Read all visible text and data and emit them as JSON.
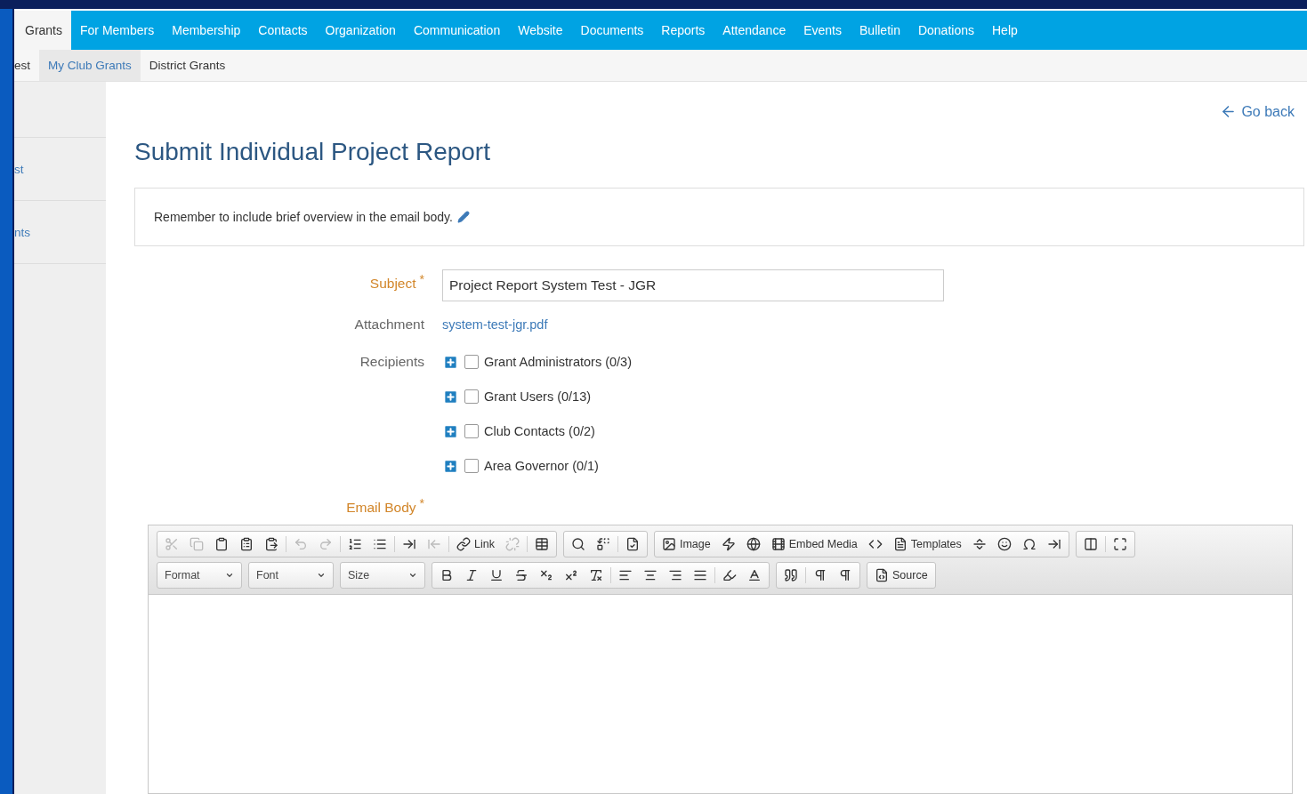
{
  "nav": {
    "tabs": [
      {
        "label": "Grants",
        "selected": true
      },
      {
        "label": "For Members",
        "selected": false
      },
      {
        "label": "Membership",
        "selected": false
      },
      {
        "label": "Contacts",
        "selected": false
      },
      {
        "label": "Organization",
        "selected": false
      },
      {
        "label": "Communication",
        "selected": false
      },
      {
        "label": "Website",
        "selected": false
      },
      {
        "label": "Documents",
        "selected": false
      },
      {
        "label": "Reports",
        "selected": false
      },
      {
        "label": "Attendance",
        "selected": false
      },
      {
        "label": "Events",
        "selected": false
      },
      {
        "label": "Bulletin",
        "selected": false
      },
      {
        "label": "Donations",
        "selected": false
      },
      {
        "label": "Help",
        "selected": false
      }
    ]
  },
  "subnav": [
    {
      "label": "est",
      "selected": false
    },
    {
      "label": "My Club Grants",
      "selected": true
    },
    {
      "label": "District Grants",
      "selected": false
    }
  ],
  "sidebar": {
    "items": [
      {
        "label": "st"
      },
      {
        "label": "nts"
      }
    ]
  },
  "go_back": "Go back",
  "title": "Submit Individual Project Report",
  "notice": "Remember to include brief overview in the email body.",
  "form": {
    "subject": {
      "label": "Subject",
      "required_mark": "*",
      "value": "Project Report System Test - JGR"
    },
    "attachment": {
      "label": "Attachment",
      "link": "system-test-jgr.pdf"
    },
    "recipients": {
      "label": "Recipients",
      "groups": [
        {
          "label": "Grant Administrators (0/3)",
          "checked": false
        },
        {
          "label": "Grant Users (0/13)",
          "checked": false
        },
        {
          "label": "Club Contacts (0/2)",
          "checked": false
        },
        {
          "label": "Area Governor (0/1)",
          "checked": false
        }
      ]
    },
    "email_body": {
      "label": "Email Body",
      "required_mark": "*"
    }
  },
  "editor": {
    "toolbar_rows": [
      [
        [
          {
            "kind": "icon",
            "disabled": true
          },
          {
            "kind": "icon",
            "disabled": true
          },
          {
            "kind": "icon",
            "disabled": false
          },
          {
            "kind": "icon",
            "disabled": false
          },
          {
            "kind": "icon",
            "disabled": false
          },
          {
            "kind": "sep"
          },
          {
            "kind": "icon",
            "disabled": true
          },
          {
            "kind": "icon",
            "disabled": true
          },
          {
            "kind": "sep"
          },
          {
            "kind": "icon",
            "disabled": false
          },
          {
            "kind": "icon",
            "disabled": false
          },
          {
            "kind": "sep"
          },
          {
            "kind": "icon",
            "disabled": false
          },
          {
            "kind": "icon",
            "disabled": true
          },
          {
            "kind": "sep"
          },
          {
            "kind": "label",
            "label": "Link",
            "disabled": false
          },
          {
            "kind": "icon",
            "disabled": true
          },
          {
            "kind": "sep"
          },
          {
            "kind": "icon",
            "disabled": false
          }
        ],
        [
          {
            "kind": "icon",
            "disabled": false
          },
          {
            "kind": "icon",
            "disabled": false
          },
          {
            "kind": "sep"
          },
          {
            "kind": "icon",
            "disabled": false
          }
        ],
        [
          {
            "kind": "label",
            "label": "Image",
            "disabled": false
          },
          {
            "kind": "icon",
            "disabled": false
          },
          {
            "kind": "icon",
            "disabled": false
          },
          {
            "kind": "label",
            "label": "Embed Media",
            "disabled": false
          },
          {
            "kind": "icon",
            "disabled": false
          },
          {
            "kind": "label",
            "label": "Templates",
            "disabled": false
          },
          {
            "kind": "icon",
            "disabled": false
          },
          {
            "kind": "icon",
            "disabled": false
          },
          {
            "kind": "icon",
            "disabled": false
          },
          {
            "kind": "icon",
            "disabled": false
          }
        ],
        [
          {
            "kind": "icon",
            "disabled": false
          },
          {
            "kind": "sep"
          },
          {
            "kind": "icon",
            "disabled": false
          }
        ]
      ],
      [
        [
          {
            "kind": "combo",
            "label": "Format"
          }
        ],
        [
          {
            "kind": "combo",
            "label": "Font"
          }
        ],
        [
          {
            "kind": "combo",
            "label": "Size"
          }
        ],
        [
          {
            "kind": "icon",
            "disabled": false
          },
          {
            "kind": "icon",
            "disabled": false
          },
          {
            "kind": "icon",
            "disabled": false
          },
          {
            "kind": "icon",
            "disabled": false
          },
          {
            "kind": "icon",
            "disabled": false
          },
          {
            "kind": "icon",
            "disabled": false
          },
          {
            "kind": "icon",
            "disabled": false
          },
          {
            "kind": "sep"
          },
          {
            "kind": "icon",
            "disabled": false
          },
          {
            "kind": "icon",
            "disabled": false
          },
          {
            "kind": "icon",
            "disabled": false
          },
          {
            "kind": "icon",
            "disabled": false
          },
          {
            "kind": "sep"
          },
          {
            "kind": "icon",
            "disabled": false
          },
          {
            "kind": "icon",
            "disabled": false
          }
        ],
        [
          {
            "kind": "icon",
            "disabled": false
          },
          {
            "kind": "sep"
          },
          {
            "kind": "icon",
            "disabled": false
          },
          {
            "kind": "icon",
            "disabled": false
          }
        ],
        [
          {
            "kind": "label",
            "label": "Source",
            "disabled": false
          }
        ]
      ]
    ]
  }
}
